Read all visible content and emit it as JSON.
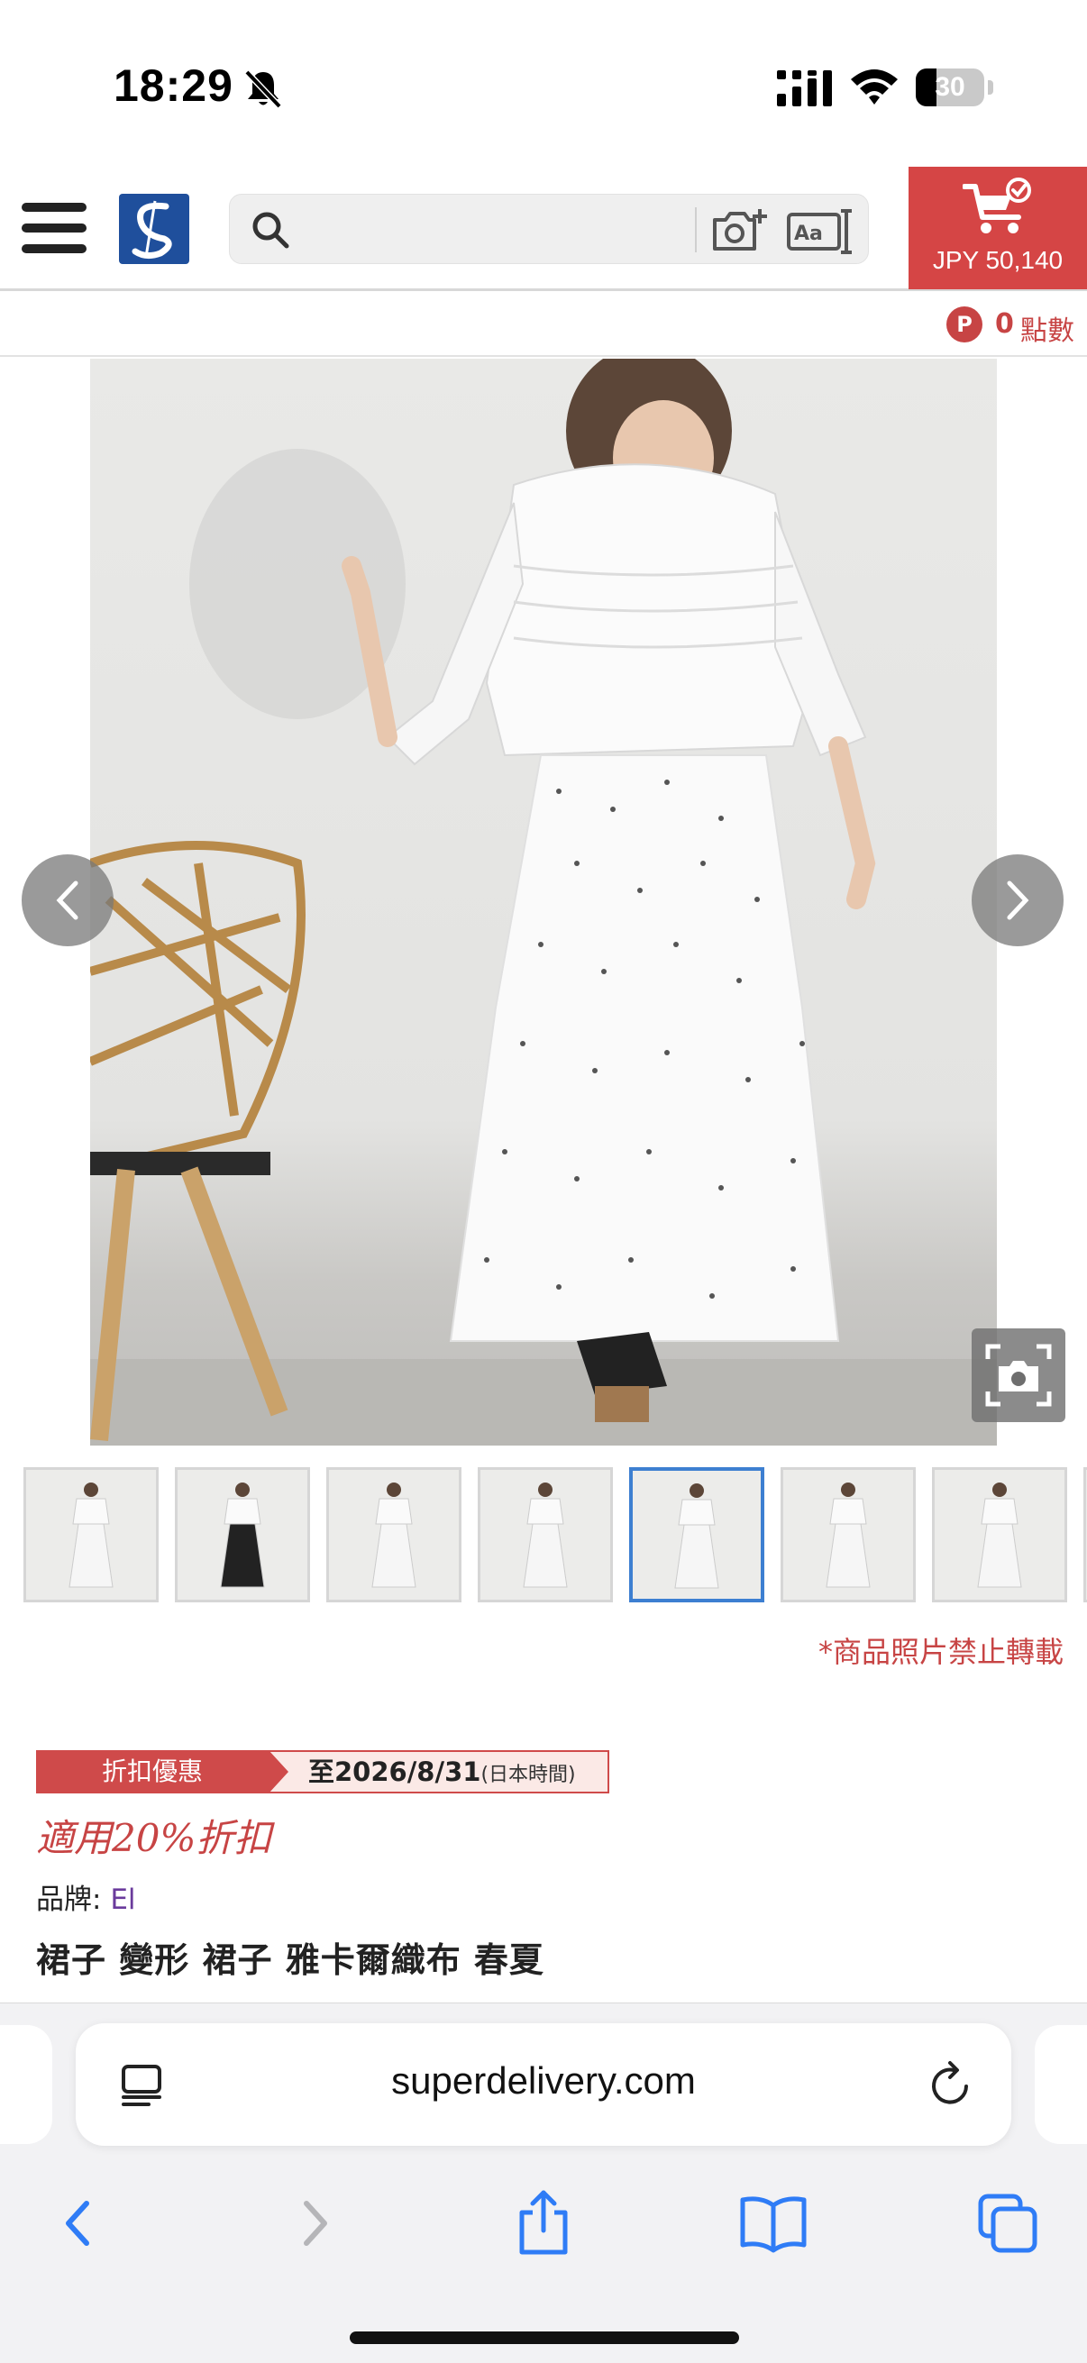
{
  "status_bar": {
    "time": "18:29",
    "battery_level": "30",
    "battery_fraction": 0.3
  },
  "header": {
    "search": {
      "placeholder": ""
    },
    "cart": {
      "total": "JPY 50,140"
    },
    "colors": {
      "cart_bg": "#d54545",
      "logo_bg": "#1f4f9c"
    }
  },
  "points": {
    "badge": "P",
    "value": "0",
    "unit": "點數"
  },
  "gallery": {
    "photo_note": "*商品照片禁止轉載",
    "thumbnail_count": 8,
    "selected_thumbnail_index": 5
  },
  "product": {
    "promo_label": "折扣優惠",
    "promo_date": "至2026/8/31",
    "promo_timezone": "(日本時間)",
    "discount": "適用20%折扣",
    "brand_label": "品牌: ",
    "brand_name": "El",
    "title": "裙子 變形 裙子 雅卡爾織布 春夏"
  },
  "browser": {
    "url": "superdelivery.com"
  },
  "icons": {
    "status": [
      "bell-slash-icon",
      "signal-icon",
      "wifi-icon",
      "battery-icon"
    ],
    "header": [
      "menu-icon",
      "logo",
      "search-icon",
      "camera-search-icon",
      "text-scan-icon",
      "cart-icon"
    ],
    "toolbar": [
      "back-icon",
      "forward-icon",
      "share-icon",
      "bookmarks-icon",
      "tabs-icon"
    ]
  }
}
